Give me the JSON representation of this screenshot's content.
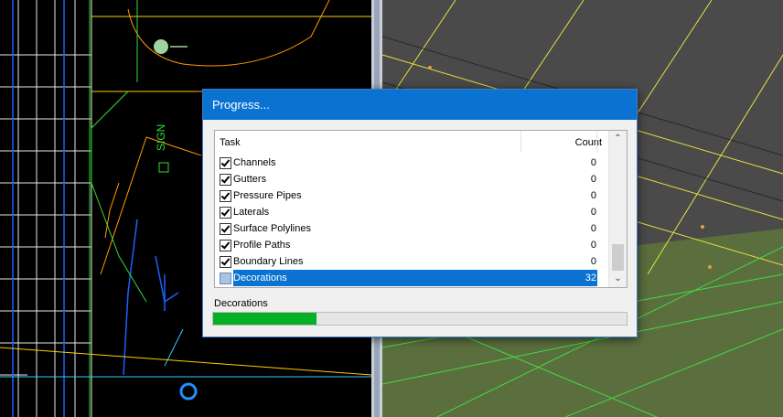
{
  "dialog": {
    "title": "Progress...",
    "list": {
      "headers": {
        "task": "Task",
        "count": "Count"
      },
      "rows": [
        {
          "name": "Channels",
          "count": "0",
          "checked": true,
          "selected": false
        },
        {
          "name": "Gutters",
          "count": "0",
          "checked": true,
          "selected": false
        },
        {
          "name": "Pressure Pipes",
          "count": "0",
          "checked": true,
          "selected": false
        },
        {
          "name": "Laterals",
          "count": "0",
          "checked": true,
          "selected": false
        },
        {
          "name": "Surface Polylines",
          "count": "0",
          "checked": true,
          "selected": false
        },
        {
          "name": "Profile Paths",
          "count": "0",
          "checked": true,
          "selected": false
        },
        {
          "name": "Boundary Lines",
          "count": "0",
          "checked": true,
          "selected": false
        },
        {
          "name": "Decorations",
          "count": "32",
          "checked": false,
          "selected": true
        }
      ]
    },
    "status_label": "Decorations",
    "progress_fraction": 0.25
  },
  "plan_view": {
    "annotation": "SIGN"
  },
  "icons": {
    "scroll_up": "chevron-up-icon",
    "scroll_down": "chevron-down-icon",
    "checkbox": "check-icon"
  },
  "colors": {
    "title_bar": "#0a72d1",
    "selection": "#0a72d1",
    "progress": "#06b025"
  }
}
